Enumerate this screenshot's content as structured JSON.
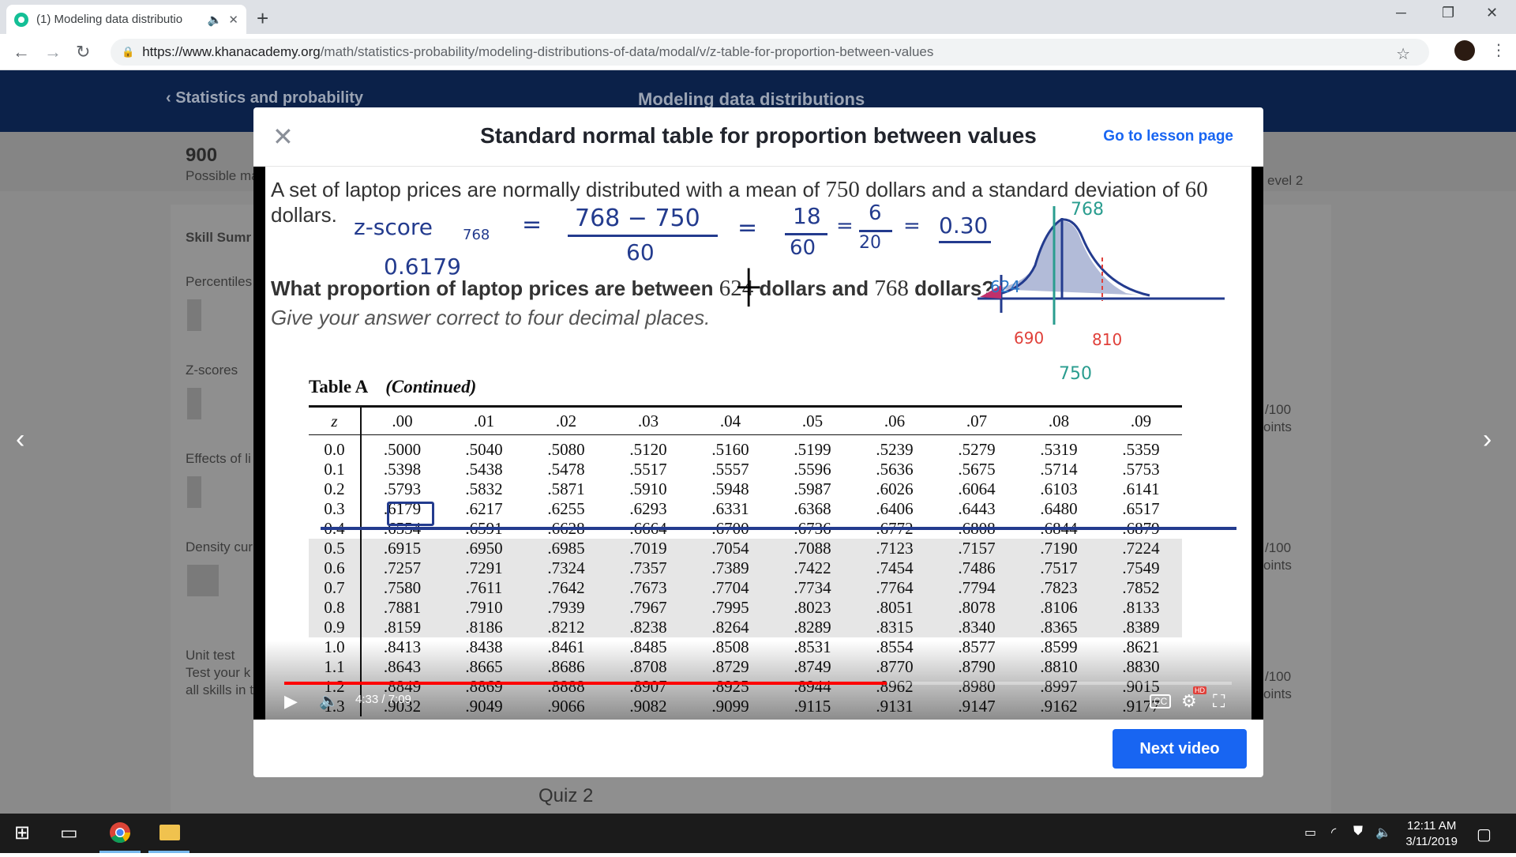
{
  "browser": {
    "tab_title": "(1) Modeling data distributio",
    "new_tab": "+",
    "url_host": "https://www.khanacademy.org",
    "url_path": "/math/statistics-probability/modeling-distributions-of-data/modal/v/z-table-for-proportion-between-values",
    "window_min": "─",
    "window_max": "❐",
    "window_close": "✕"
  },
  "background_page": {
    "back_link": "Statistics and probability",
    "center_title": "Modeling data distributions",
    "points": "900",
    "points_label": "Possible ma",
    "skill_summary": "Skill Sumr",
    "percentiles": "Percentiles",
    "zscores": "Z-scores",
    "effects": "Effects of li",
    "density": "Density cur",
    "unit_test": "Unit test",
    "unit_test_desc1": "Test your k",
    "unit_test_desc2": "all skills in t",
    "level": "evel 2",
    "pts1": "/100",
    "pts1b": "oints",
    "pts2": "/100",
    "pts2b": "oints",
    "pts3": "/100",
    "pts3b": "oints",
    "quiz2": "Quiz 2"
  },
  "modal": {
    "title": "Standard normal table for proportion between values",
    "lesson_link": "Go to lesson page",
    "next_button": "Next video"
  },
  "video": {
    "question_line1a": "A set of laptop prices are normally distributed with a mean of ",
    "mean": "750",
    "question_line1b": " dollars and a standard deviation of ",
    "sd": "60",
    "question_line1c": "dollars.",
    "question2a": "What proportion of laptop prices are between ",
    "low": "624",
    "question2b": " dollars and ",
    "high": "768",
    "question2c": " dollars?",
    "question3": "Give your answer correct to four decimal places.",
    "ink_zscore": "z-score",
    "ink_768sub": "768",
    "ink_eq1": "=",
    "ink_frac1_num": "768 − 750",
    "ink_frac1_den": "60",
    "ink_eq2": "=",
    "ink_frac2_num": "18",
    "ink_frac2_den": "60",
    "ink_eq3": "=",
    "ink_frac3_num": "6",
    "ink_frac3_den": "20",
    "ink_eq4": "=",
    "ink_result": "0.30",
    "ink_prob": "0.6179",
    "curve_label_768": "768",
    "curve_label_624": "624",
    "curve_label_690": "690",
    "curve_label_810": "810",
    "curve_label_750": "750",
    "time_display": "4:33 / 7:09",
    "progress_fraction": 0.636,
    "cc": "CC",
    "hd": "HD"
  },
  "table": {
    "title": "Table A",
    "subtitle": "(Continued)",
    "headers": [
      "z",
      ".00",
      ".01",
      ".02",
      ".03",
      ".04",
      ".05",
      ".06",
      ".07",
      ".08",
      ".09"
    ],
    "rows": [
      [
        "0.0",
        ".5000",
        ".5040",
        ".5080",
        ".5120",
        ".5160",
        ".5199",
        ".5239",
        ".5279",
        ".5319",
        ".5359"
      ],
      [
        "0.1",
        ".5398",
        ".5438",
        ".5478",
        ".5517",
        ".5557",
        ".5596",
        ".5636",
        ".5675",
        ".5714",
        ".5753"
      ],
      [
        "0.2",
        ".5793",
        ".5832",
        ".5871",
        ".5910",
        ".5948",
        ".5987",
        ".6026",
        ".6064",
        ".6103",
        ".6141"
      ],
      [
        "0.3",
        ".6179",
        ".6217",
        ".6255",
        ".6293",
        ".6331",
        ".6368",
        ".6406",
        ".6443",
        ".6480",
        ".6517"
      ],
      [
        "0.4",
        ".6554",
        ".6591",
        ".6628",
        ".6664",
        ".6700",
        ".6736",
        ".6772",
        ".6808",
        ".6844",
        ".6879"
      ],
      [
        "0.5",
        ".6915",
        ".6950",
        ".6985",
        ".7019",
        ".7054",
        ".7088",
        ".7123",
        ".7157",
        ".7190",
        ".7224"
      ],
      [
        "0.6",
        ".7257",
        ".7291",
        ".7324",
        ".7357",
        ".7389",
        ".7422",
        ".7454",
        ".7486",
        ".7517",
        ".7549"
      ],
      [
        "0.7",
        ".7580",
        ".7611",
        ".7642",
        ".7673",
        ".7704",
        ".7734",
        ".7764",
        ".7794",
        ".7823",
        ".7852"
      ],
      [
        "0.8",
        ".7881",
        ".7910",
        ".7939",
        ".7967",
        ".7995",
        ".8023",
        ".8051",
        ".8078",
        ".8106",
        ".8133"
      ],
      [
        "0.9",
        ".8159",
        ".8186",
        ".8212",
        ".8238",
        ".8264",
        ".8289",
        ".8315",
        ".8340",
        ".8365",
        ".8389"
      ],
      [
        "1.0",
        ".8413",
        ".8438",
        ".8461",
        ".8485",
        ".8508",
        ".8531",
        ".8554",
        ".8577",
        ".8599",
        ".8621"
      ],
      [
        "1.1",
        ".8643",
        ".8665",
        ".8686",
        ".8708",
        ".8729",
        ".8749",
        ".8770",
        ".8790",
        ".8810",
        ".8830"
      ],
      [
        "1.2",
        ".8849",
        ".8869",
        ".8888",
        ".8907",
        ".8925",
        ".8944",
        ".8962",
        ".8980",
        ".8997",
        ".9015"
      ],
      [
        "1.3",
        ".9032",
        ".9049",
        ".9066",
        ".9082",
        ".9099",
        ".9115",
        ".9131",
        ".9147",
        ".9162",
        ".9177"
      ]
    ]
  },
  "taskbar": {
    "time": "12:11 AM",
    "date": "3/11/2019"
  },
  "colors": {
    "ink_blue": "#233b8e",
    "ink_red": "#e0403a",
    "ink_teal": "#2a9d8f",
    "accent": "#1865f2",
    "progress": "#ff0000"
  }
}
